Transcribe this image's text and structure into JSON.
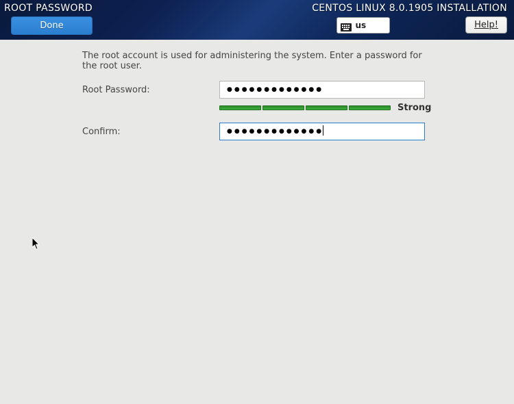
{
  "header": {
    "page_title": "ROOT PASSWORD",
    "installer_title": "CENTOS LINUX 8.0.1905 INSTALLATION",
    "done_label": "Done",
    "help_label": "Help!",
    "keyboard_layout": "us"
  },
  "form": {
    "description": "The root account is used for administering the system.  Enter a password for the root user.",
    "password_label": "Root Password:",
    "confirm_label": "Confirm:",
    "strength_label": "Strong"
  }
}
